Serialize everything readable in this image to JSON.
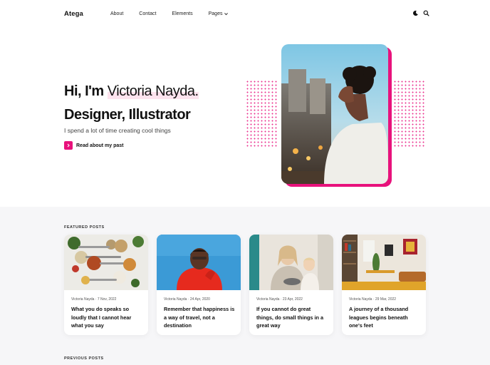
{
  "brand": "Atega",
  "nav": {
    "items": [
      "About",
      "Contact",
      "Elements",
      "Pages"
    ],
    "icons": [
      "moon-icon",
      "search-icon"
    ]
  },
  "hero": {
    "greeting": "Hi, I'm ",
    "name": "Victoria Nayda.",
    "roles": "Designer, Illustrator",
    "tagline": "I spend a lot of time creating cool things",
    "cta": "Read about my past"
  },
  "featured": {
    "label": "FEATURED POSTS",
    "posts": [
      {
        "meta": "Victoria Nayda · 7 Nov, 2022",
        "title": "What you do speaks so loudly that I cannot hear what you say"
      },
      {
        "meta": "Victoria Nayda · 24 Apr, 2020",
        "title": "Remember that happiness is a way of travel, not a destination"
      },
      {
        "meta": "Victoria Nayda · 23 Apr, 2022",
        "title": "If you cannot do great things, do small things in a great way"
      },
      {
        "meta": "Victoria Nayda · 29 Mar, 2022",
        "title": "A journey of a thousand leagues begins beneath one's feet"
      }
    ]
  },
  "previous": {
    "label": "PREVIOUS POSTS"
  },
  "colors": {
    "accent": "#e8127c",
    "background": "#f6f6f8",
    "surface": "#ffffff"
  }
}
